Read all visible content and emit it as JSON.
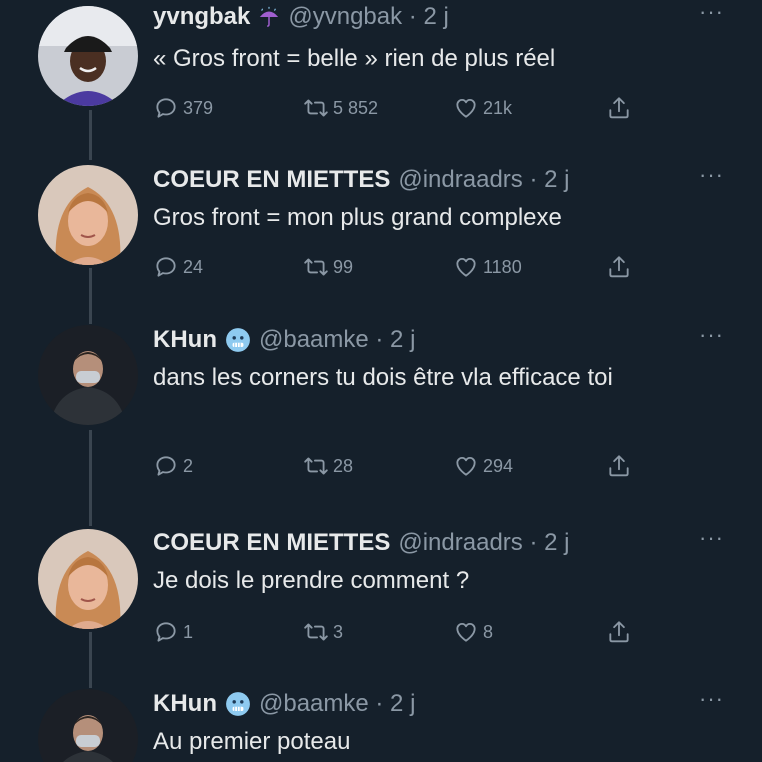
{
  "icons": {
    "reply": "speech-bubble-icon",
    "retweet": "retweet-arrows-icon",
    "like": "heart-icon",
    "share": "share-upload-icon",
    "more": "ellipsis-icon"
  },
  "colors": {
    "background": "#15202b",
    "text": "#e7e9ea",
    "muted": "#8b98a5",
    "thread_line": "#3a4550"
  },
  "tweets": [
    {
      "name": "yvngbak",
      "badge_icon": "umbrella-rain-emoji-icon",
      "handle": "@yvngbak · 2 j",
      "text": "« Gros front = belle » rien de plus réel",
      "replies": "379",
      "retweets": "5 852",
      "likes": "21k",
      "more": "···"
    },
    {
      "name": "COEUR EN MIETTES",
      "handle": "@indraadrs · 2 j",
      "text": "Gros front = mon plus grand complexe",
      "replies": "24",
      "retweets": "99",
      "likes": "1180",
      "more": "···"
    },
    {
      "name": "KHun",
      "badge_icon": "cold-face-emoji-icon",
      "handle": "@baamke · 2 j",
      "text": "dans les corners tu dois être vla efficace toi",
      "replies": "2",
      "retweets": "28",
      "likes": "294",
      "more": "···"
    },
    {
      "name": "COEUR EN MIETTES",
      "handle": "@indraadrs · 2 j",
      "text": "Je dois le prendre comment ?",
      "replies": "1",
      "retweets": "3",
      "likes": "8",
      "more": "···"
    },
    {
      "name": "KHun",
      "badge_icon": "cold-face-emoji-icon",
      "handle": "@baamke · 2 j",
      "text": "Au premier poteau",
      "more": "···"
    }
  ]
}
